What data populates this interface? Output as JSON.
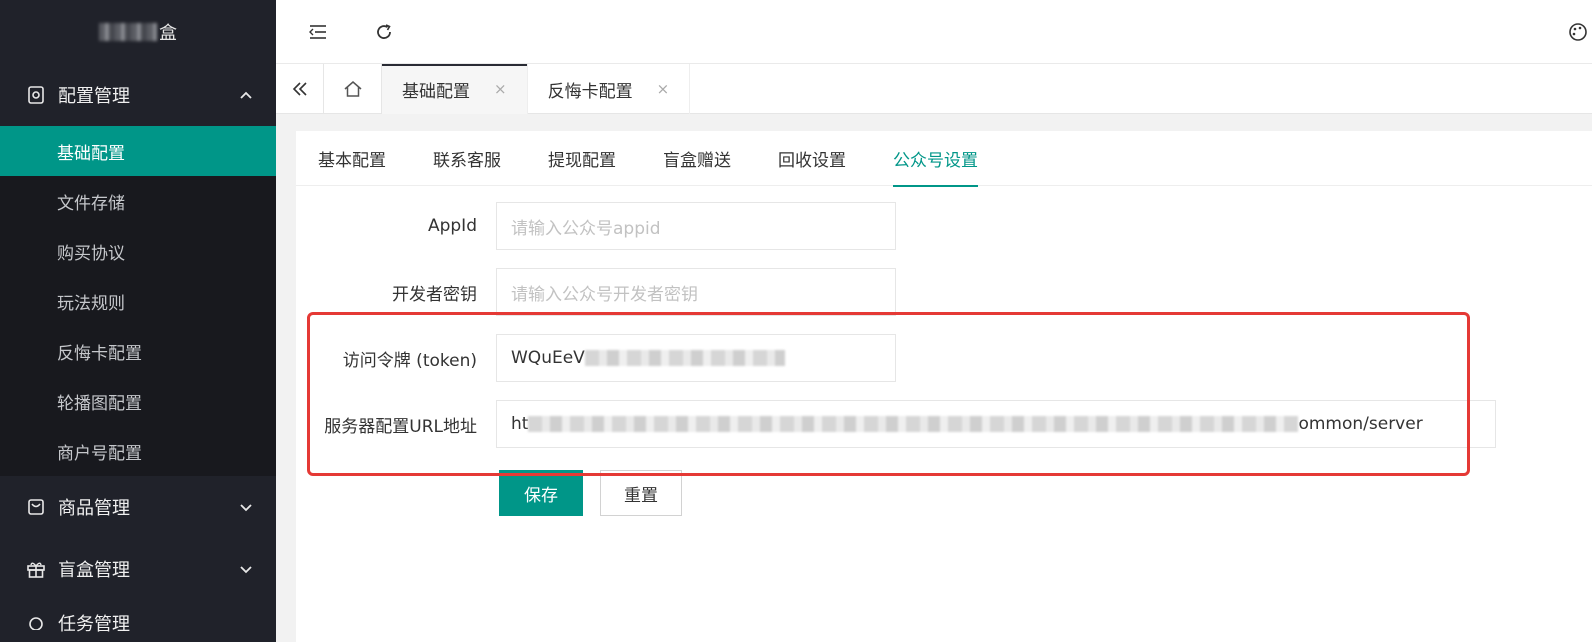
{
  "app": {
    "logo_suffix": "盒"
  },
  "sidebar": {
    "groups": [
      {
        "label": "配置管理",
        "icon": "settings-icon",
        "expanded": true
      },
      {
        "label": "商品管理",
        "icon": "bag-icon",
        "expanded": false
      },
      {
        "label": "盲盒管理",
        "icon": "gift-icon",
        "expanded": false
      },
      {
        "label": "任务管理",
        "icon": "task-icon",
        "expanded": false
      }
    ],
    "sub_items": [
      "基础配置",
      "文件存储",
      "购买协议",
      "玩法规则",
      "反悔卡配置",
      "轮播图配置",
      "商户号配置"
    ]
  },
  "tabbar": {
    "tabs": [
      {
        "label": "基础配置",
        "close": "×"
      },
      {
        "label": "反悔卡配置",
        "close": "×"
      }
    ]
  },
  "content": {
    "tabs": [
      "基本配置",
      "联系客服",
      "提现配置",
      "盲盒赠送",
      "回收设置",
      "公众号设置"
    ],
    "active_tab": "公众号设置",
    "form": {
      "appid": {
        "label": "AppId",
        "placeholder": "请输入公众号appid"
      },
      "secret": {
        "label": "开发者密钥",
        "placeholder": "请输入公众号开发者密钥"
      },
      "token": {
        "label": "访问令牌 (token)",
        "value_visible": "WQuEeV"
      },
      "server_url": {
        "label": "服务器配置URL地址",
        "value_prefix": "ht",
        "value_suffix": "ommon/server"
      }
    },
    "buttons": {
      "save": "保存",
      "reset": "重置"
    }
  },
  "colors": {
    "accent": "#009688",
    "sidebar_bg": "#20222a",
    "highlight": "#e53935"
  }
}
